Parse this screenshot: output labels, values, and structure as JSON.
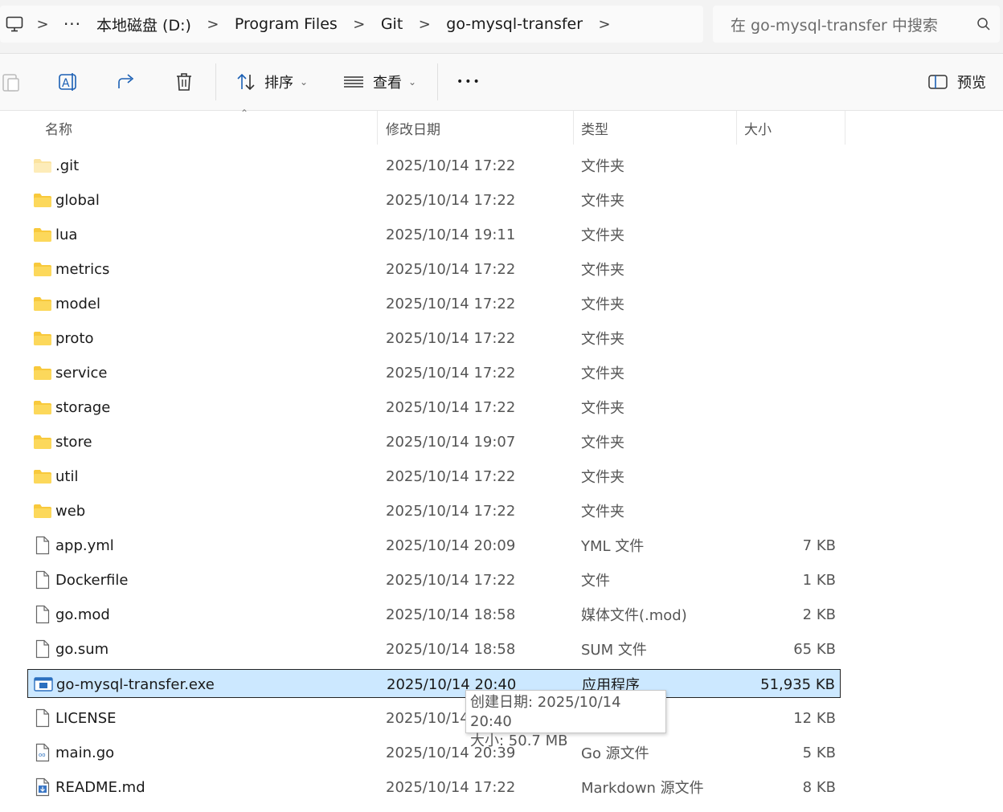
{
  "address": {
    "more": "···",
    "crumbs": [
      "本地磁盘 (D:)",
      "Program Files",
      "Git",
      "go-mysql-transfer"
    ],
    "separator": ">"
  },
  "search": {
    "placeholder": "在 go-mysql-transfer 中搜索"
  },
  "toolbar": {
    "sort_label": "排序",
    "view_label": "查看",
    "more_label": "•••",
    "preview_label": "预览"
  },
  "columns": {
    "name": "名称",
    "date": "修改日期",
    "type": "类型",
    "size": "大小"
  },
  "files": [
    {
      "name": ".git",
      "date": "2025/10/14 17:22",
      "type": "文件夹",
      "size": "",
      "icon": "folder-light-icon"
    },
    {
      "name": "global",
      "date": "2025/10/14 17:22",
      "type": "文件夹",
      "size": "",
      "icon": "folder-icon"
    },
    {
      "name": "lua",
      "date": "2025/10/14 19:11",
      "type": "文件夹",
      "size": "",
      "icon": "folder-icon"
    },
    {
      "name": "metrics",
      "date": "2025/10/14 17:22",
      "type": "文件夹",
      "size": "",
      "icon": "folder-icon"
    },
    {
      "name": "model",
      "date": "2025/10/14 17:22",
      "type": "文件夹",
      "size": "",
      "icon": "folder-icon"
    },
    {
      "name": "proto",
      "date": "2025/10/14 17:22",
      "type": "文件夹",
      "size": "",
      "icon": "folder-icon"
    },
    {
      "name": "service",
      "date": "2025/10/14 17:22",
      "type": "文件夹",
      "size": "",
      "icon": "folder-icon"
    },
    {
      "name": "storage",
      "date": "2025/10/14 17:22",
      "type": "文件夹",
      "size": "",
      "icon": "folder-icon"
    },
    {
      "name": "store",
      "date": "2025/10/14 19:07",
      "type": "文件夹",
      "size": "",
      "icon": "folder-icon"
    },
    {
      "name": "util",
      "date": "2025/10/14 17:22",
      "type": "文件夹",
      "size": "",
      "icon": "folder-icon"
    },
    {
      "name": "web",
      "date": "2025/10/14 17:22",
      "type": "文件夹",
      "size": "",
      "icon": "folder-icon"
    },
    {
      "name": "app.yml",
      "date": "2025/10/14 20:09",
      "type": "YML 文件",
      "size": "7 KB",
      "icon": "file-icon"
    },
    {
      "name": "Dockerfile",
      "date": "2025/10/14 17:22",
      "type": "文件",
      "size": "1 KB",
      "icon": "file-icon"
    },
    {
      "name": "go.mod",
      "date": "2025/10/14 18:58",
      "type": "媒体文件(.mod)",
      "size": "2 KB",
      "icon": "file-icon"
    },
    {
      "name": "go.sum",
      "date": "2025/10/14 18:58",
      "type": "SUM 文件",
      "size": "65 KB",
      "icon": "file-icon"
    },
    {
      "name": "go-mysql-transfer.exe",
      "date": "2025/10/14 20:40",
      "type": "应用程序",
      "size": "51,935 KB",
      "icon": "exe-icon",
      "selected": true
    },
    {
      "name": "LICENSE",
      "date": "2025/10/14",
      "type": "",
      "size": "12 KB",
      "icon": "file-icon"
    },
    {
      "name": "main.go",
      "date": "2025/10/14 20:39",
      "type": "Go 源文件",
      "size": "5 KB",
      "icon": "go-file-icon"
    },
    {
      "name": "README.md",
      "date": "2025/10/14 17:22",
      "type": "Markdown 源文件",
      "size": "8 KB",
      "icon": "markdown-file-icon"
    }
  ],
  "tooltip": {
    "line1": "创建日期: 2025/10/14 20:40",
    "line2": "大小: 50.7 MB"
  },
  "colors": {
    "selection": "#cce8ff",
    "folder": "#f8c93c",
    "accent": "#0067c0"
  }
}
